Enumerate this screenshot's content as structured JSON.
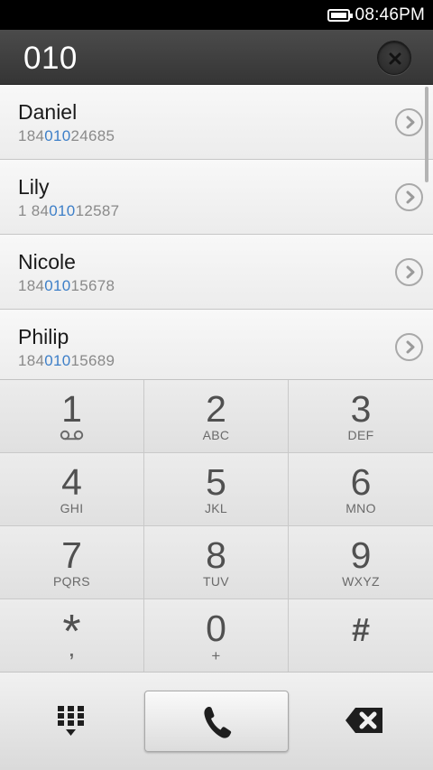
{
  "status_bar": {
    "time": "08:46PM"
  },
  "dialer": {
    "dialed_number": "010"
  },
  "contacts": [
    {
      "name": "Daniel",
      "number_prefix": "184",
      "number_match": "010",
      "number_suffix": "24685"
    },
    {
      "name": "Lily",
      "number_prefix": "1 84",
      "number_match": "010",
      "number_suffix": "12587"
    },
    {
      "name": "Nicole",
      "number_prefix": "184",
      "number_match": "010",
      "number_suffix": "15678"
    },
    {
      "name": "Philip",
      "number_prefix": "184",
      "number_match": "010",
      "number_suffix": "15689"
    }
  ],
  "keypad": [
    {
      "digit": "1",
      "letters": ""
    },
    {
      "digit": "2",
      "letters": "ABC"
    },
    {
      "digit": "3",
      "letters": "DEF"
    },
    {
      "digit": "4",
      "letters": "GHI"
    },
    {
      "digit": "5",
      "letters": "JKL"
    },
    {
      "digit": "6",
      "letters": "MNO"
    },
    {
      "digit": "7",
      "letters": "PQRS"
    },
    {
      "digit": "8",
      "letters": "TUV"
    },
    {
      "digit": "9",
      "letters": "WXYZ"
    },
    {
      "digit": "*",
      "letters": ","
    },
    {
      "digit": "0",
      "letters": "+"
    },
    {
      "digit": "#",
      "letters": ""
    }
  ],
  "icons": {
    "battery": "battery-icon",
    "clear": "clear-x-icon",
    "contact_detail": "chevron-right-icon",
    "voicemail": "voicemail-icon",
    "dialpad_toggle": "dialpad-grid-icon",
    "call": "phone-handset-icon",
    "backspace": "backspace-icon"
  },
  "colors": {
    "match_highlight": "#3d7fc8",
    "header_bg": "#3f3f3f",
    "status_bar_bg": "#000000"
  }
}
